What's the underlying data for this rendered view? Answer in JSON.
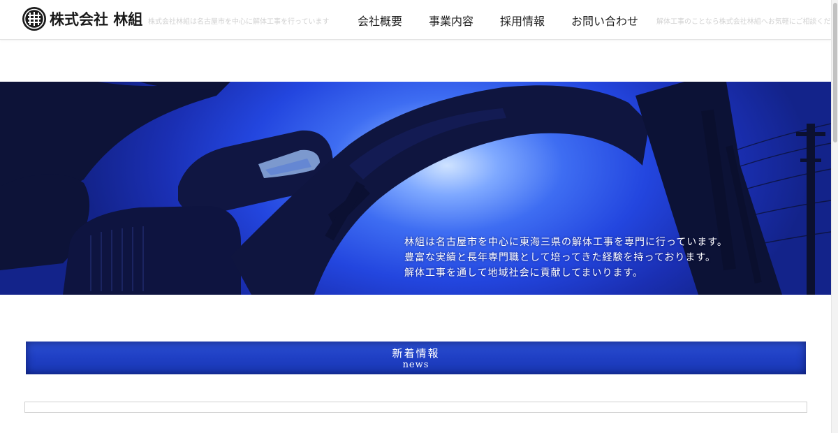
{
  "header": {
    "company_name": "株式会社 林組",
    "logo_icon": "company-crest-icon",
    "background_texts": [
      "株式会社林組は名古屋市を中心に解体工事を行っています",
      "解体工事のことなら株式会社林組へお気軽にご相談ください"
    ],
    "nav": [
      {
        "label": "会社概要"
      },
      {
        "label": "事業内容"
      },
      {
        "label": "採用情報"
      },
      {
        "label": "お問い合わせ"
      }
    ]
  },
  "hero": {
    "image": "excavator-silhouette-image",
    "caption": [
      "林組は名古屋市を中心に東海三県の解体工事を専門に行っています。",
      "豊富な実績と長年専門職として培ってきた経験を持っております。",
      "解体工事を通して地域社会に貢献してまいります。"
    ]
  },
  "news": {
    "title": "新着情報",
    "subtitle": "news"
  },
  "colors": {
    "accent": "#1f3fc4",
    "hero_sky": "#2346df",
    "silhouette": "#0e1440",
    "text": "#222222"
  }
}
